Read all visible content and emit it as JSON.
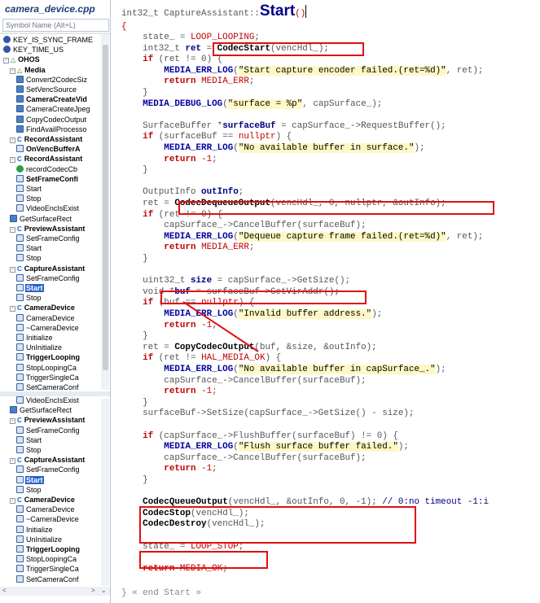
{
  "sidebar": {
    "file_title": "camera_device.cpp",
    "search_placeholder": "Symbol Name (Alt+L)",
    "items": [
      {
        "label": "KEY_IS_SYNC_FRAME",
        "icon": "key",
        "indent": 0
      },
      {
        "label": "KEY_TIME_US",
        "icon": "key",
        "indent": 0
      },
      {
        "label": "OHOS",
        "icon": "namespace",
        "indent": 0,
        "bold": true,
        "toggle": "-"
      },
      {
        "label": "Media",
        "icon": "namespace",
        "indent": 1,
        "bold": true,
        "toggle": "-"
      },
      {
        "label": "Convert2CodecSiz",
        "icon": "func",
        "indent": 2
      },
      {
        "label": "SetVencSource",
        "icon": "func",
        "indent": 2
      },
      {
        "label": "CameraCreateVid",
        "icon": "func",
        "indent": 2,
        "bold": true
      },
      {
        "label": "CameraCreateJpeg",
        "icon": "func",
        "indent": 2
      },
      {
        "label": "CopyCodecOutput",
        "icon": "func",
        "indent": 2
      },
      {
        "label": "FindAvailProcesso",
        "icon": "func",
        "indent": 2
      },
      {
        "label": "RecordAssistant",
        "icon": "class",
        "indent": 1,
        "bold": true,
        "toggle": "-"
      },
      {
        "label": "OnVencBufferA",
        "icon": "method",
        "indent": 2,
        "bold": true
      },
      {
        "label": "RecordAssistant",
        "icon": "class",
        "indent": 1,
        "bold": true,
        "toggle": "-"
      },
      {
        "label": "recordCodecCb",
        "icon": "green",
        "indent": 2
      },
      {
        "label": "SetFrameConfi",
        "icon": "method",
        "indent": 2,
        "bold": true
      },
      {
        "label": "Start",
        "icon": "method",
        "indent": 2
      },
      {
        "label": "Stop",
        "icon": "method",
        "indent": 2
      },
      {
        "label": "VideoEncIsExist",
        "icon": "method",
        "indent": 2
      },
      {
        "label": "GetSurfaceRect",
        "icon": "func",
        "indent": 1
      },
      {
        "label": "PreviewAssistant",
        "icon": "class",
        "indent": 1,
        "bold": true,
        "toggle": "-"
      },
      {
        "label": "SetFrameConfig",
        "icon": "method",
        "indent": 2
      },
      {
        "label": "Start",
        "icon": "method",
        "indent": 2
      },
      {
        "label": "Stop",
        "icon": "method",
        "indent": 2
      },
      {
        "label": "CaptureAssistant",
        "icon": "class",
        "indent": 1,
        "bold": true,
        "toggle": "-"
      },
      {
        "label": "SetFrameConfig",
        "icon": "method",
        "indent": 2
      },
      {
        "label": "Start",
        "icon": "method",
        "indent": 2,
        "bold": true,
        "selected": true
      },
      {
        "label": "Stop",
        "icon": "method",
        "indent": 2
      },
      {
        "label": "CameraDevice",
        "icon": "class",
        "indent": 1,
        "bold": true,
        "toggle": "-"
      },
      {
        "label": "CameraDevice",
        "icon": "method",
        "indent": 2
      },
      {
        "label": "~CameraDevice",
        "icon": "method",
        "indent": 2
      },
      {
        "label": "Initialize",
        "icon": "method",
        "indent": 2
      },
      {
        "label": "UnInitialize",
        "icon": "method",
        "indent": 2
      },
      {
        "label": "TriggerLooping",
        "icon": "method",
        "indent": 2,
        "bold": true
      },
      {
        "label": "StopLoopingCa",
        "icon": "method",
        "indent": 2
      },
      {
        "label": "TriggerSingleCa",
        "icon": "method",
        "indent": 2
      },
      {
        "label": "SetCameraConf",
        "icon": "method",
        "indent": 2
      }
    ],
    "items2": [
      {
        "label": "VideoEncIsExist",
        "icon": "method",
        "indent": 2
      },
      {
        "label": "GetSurfaceRect",
        "icon": "func",
        "indent": 1
      },
      {
        "label": "PreviewAssistant",
        "icon": "class",
        "indent": 1,
        "bold": true,
        "toggle": "-"
      },
      {
        "label": "SetFrameConfig",
        "icon": "method",
        "indent": 2
      },
      {
        "label": "Start",
        "icon": "method",
        "indent": 2
      },
      {
        "label": "Stop",
        "icon": "method",
        "indent": 2
      },
      {
        "label": "CaptureAssistant",
        "icon": "class",
        "indent": 1,
        "bold": true,
        "toggle": "-"
      },
      {
        "label": "SetFrameConfig",
        "icon": "method",
        "indent": 2
      },
      {
        "label": "Start",
        "icon": "method",
        "indent": 2,
        "bold": true,
        "selected": true
      },
      {
        "label": "Stop",
        "icon": "method",
        "indent": 2
      },
      {
        "label": "CameraDevice",
        "icon": "class",
        "indent": 1,
        "bold": true,
        "toggle": "-"
      },
      {
        "label": "CameraDevice",
        "icon": "method",
        "indent": 2
      },
      {
        "label": "~CameraDevice",
        "icon": "method",
        "indent": 2
      },
      {
        "label": "Initialize",
        "icon": "method",
        "indent": 2
      },
      {
        "label": "UnInitialize",
        "icon": "method",
        "indent": 2
      },
      {
        "label": "TriggerLooping",
        "icon": "method",
        "indent": 2,
        "bold": true
      },
      {
        "label": "StopLoopingCa",
        "icon": "method",
        "indent": 2
      },
      {
        "label": "TriggerSingleCa",
        "icon": "method",
        "indent": 2
      },
      {
        "label": "SetCameraConf",
        "icon": "method",
        "indent": 2
      }
    ]
  },
  "code": {
    "header_prefix": "int32_t CaptureAssistant::",
    "header_func": "Start",
    "header_suffix": "()",
    "open_brace": "{",
    "end_comment": "} « end Start »",
    "lines": [
      [
        [
          "t",
          "    state_ = "
        ],
        [
          "num",
          "LOOP_LOOPING"
        ],
        [
          "t",
          ";"
        ]
      ],
      [
        [
          "t",
          "    int32_t "
        ],
        [
          "var",
          "ret"
        ],
        [
          "t",
          " = "
        ],
        [
          "fn",
          "CodecStart"
        ],
        [
          "t",
          "(vencHdl_);"
        ]
      ],
      [
        [
          "t",
          "    "
        ],
        [
          "kw",
          "if"
        ],
        [
          "t",
          " (ret != 0) {"
        ]
      ],
      [
        [
          "t",
          "        "
        ],
        [
          "mac",
          "MEDIA_ERR_LOG"
        ],
        [
          "t",
          "("
        ],
        [
          "str",
          "\"Start capture encoder failed.(ret=%d)\""
        ],
        [
          "t",
          ", ret);"
        ]
      ],
      [
        [
          "t",
          "        "
        ],
        [
          "kw",
          "return"
        ],
        [
          "t",
          " "
        ],
        [
          "num",
          "MEDIA_ERR"
        ],
        [
          "t",
          ";"
        ]
      ],
      [
        [
          "t",
          "    }"
        ]
      ],
      [
        [
          "t",
          "    "
        ],
        [
          "mac",
          "MEDIA_DEBUG_LOG"
        ],
        [
          "t",
          "("
        ],
        [
          "str",
          "\"surface = %p\""
        ],
        [
          "t",
          ", capSurface_);"
        ]
      ],
      [
        [
          "t",
          ""
        ]
      ],
      [
        [
          "t",
          "    SurfaceBuffer *"
        ],
        [
          "var",
          "surfaceBuf"
        ],
        [
          "t",
          " = capSurface_->RequestBuffer();"
        ]
      ],
      [
        [
          "t",
          "    "
        ],
        [
          "kw",
          "if"
        ],
        [
          "t",
          " (surfaceBuf == "
        ],
        [
          "num",
          "nullptr"
        ],
        [
          "t",
          ") {"
        ]
      ],
      [
        [
          "t",
          "        "
        ],
        [
          "mac",
          "MEDIA_ERR_LOG"
        ],
        [
          "t",
          "("
        ],
        [
          "str",
          "\"No available buffer in surface.\""
        ],
        [
          "t",
          ");"
        ]
      ],
      [
        [
          "t",
          "        "
        ],
        [
          "kw",
          "return"
        ],
        [
          "t",
          " "
        ],
        [
          "num",
          "-1"
        ],
        [
          "t",
          ";"
        ]
      ],
      [
        [
          "t",
          "    }"
        ]
      ],
      [
        [
          "t",
          ""
        ]
      ],
      [
        [
          "t",
          "    OutputInfo "
        ],
        [
          "var",
          "outInfo"
        ],
        [
          "t",
          ";"
        ]
      ],
      [
        [
          "t",
          "    ret = "
        ],
        [
          "fn",
          "CodecDequeueOutput"
        ],
        [
          "t",
          "(vencHdl_, 0, nullptr, &outInfo);"
        ]
      ],
      [
        [
          "t",
          "    "
        ],
        [
          "kw",
          "if"
        ],
        [
          "t",
          " (ret != 0) {"
        ]
      ],
      [
        [
          "t",
          "        capSurface_->CancelBuffer(surfaceBuf);"
        ]
      ],
      [
        [
          "t",
          "        "
        ],
        [
          "mac",
          "MEDIA_ERR_LOG"
        ],
        [
          "t",
          "("
        ],
        [
          "str",
          "\"Dequeue capture frame failed.(ret=%d)\""
        ],
        [
          "t",
          ", ret);"
        ]
      ],
      [
        [
          "t",
          "        "
        ],
        [
          "kw",
          "return"
        ],
        [
          "t",
          " "
        ],
        [
          "num",
          "MEDIA_ERR"
        ],
        [
          "t",
          ";"
        ]
      ],
      [
        [
          "t",
          "    }"
        ]
      ],
      [
        [
          "t",
          ""
        ]
      ],
      [
        [
          "t",
          "    uint32_t "
        ],
        [
          "var",
          "size"
        ],
        [
          "t",
          " = capSurface_->GetSize();"
        ]
      ],
      [
        [
          "t",
          "    void *"
        ],
        [
          "var",
          "buf"
        ],
        [
          "t",
          " = surfaceBuf->GetVirAddr();"
        ]
      ],
      [
        [
          "t",
          "    "
        ],
        [
          "kw",
          "if"
        ],
        [
          "t",
          " (buf == "
        ],
        [
          "num",
          "nullptr"
        ],
        [
          "t",
          ") {"
        ]
      ],
      [
        [
          "t",
          "        "
        ],
        [
          "mac",
          "MEDIA_ERR_LOG"
        ],
        [
          "t",
          "("
        ],
        [
          "str",
          "\"Invalid buffer address.\""
        ],
        [
          "t",
          ");"
        ]
      ],
      [
        [
          "t",
          "        "
        ],
        [
          "kw",
          "return"
        ],
        [
          "t",
          " "
        ],
        [
          "num",
          "-1"
        ],
        [
          "t",
          ";"
        ]
      ],
      [
        [
          "t",
          "    }"
        ]
      ],
      [
        [
          "t",
          "    ret = "
        ],
        [
          "fn",
          "CopyCodecOutput"
        ],
        [
          "t",
          "(buf, &size, &outInfo);"
        ]
      ],
      [
        [
          "t",
          "    "
        ],
        [
          "kw",
          "if"
        ],
        [
          "t",
          " (ret != "
        ],
        [
          "num",
          "HAL_MEDIA_OK"
        ],
        [
          "t",
          ") {"
        ]
      ],
      [
        [
          "t",
          "        "
        ],
        [
          "mac",
          "MEDIA_ERR_LOG"
        ],
        [
          "t",
          "("
        ],
        [
          "str",
          "\"No available buffer in capSurface_.\""
        ],
        [
          "t",
          ");"
        ]
      ],
      [
        [
          "t",
          "        capSurface_->CancelBuffer(surfaceBuf);"
        ]
      ],
      [
        [
          "t",
          "        "
        ],
        [
          "kw",
          "return"
        ],
        [
          "t",
          " "
        ],
        [
          "num",
          "-1"
        ],
        [
          "t",
          ";"
        ]
      ],
      [
        [
          "t",
          "    }"
        ]
      ],
      [
        [
          "t",
          "    surfaceBuf->SetSize(capSurface_->GetSize() - size);"
        ]
      ],
      [
        [
          "t",
          ""
        ]
      ],
      [
        [
          "t",
          "    "
        ],
        [
          "kw",
          "if"
        ],
        [
          "t",
          " (capSurface_->FlushBuffer(surfaceBuf) != 0) {"
        ]
      ],
      [
        [
          "t",
          "        "
        ],
        [
          "mac",
          "MEDIA_ERR_LOG"
        ],
        [
          "t",
          "("
        ],
        [
          "str",
          "\"Flush surface buffer failed.\""
        ],
        [
          "t",
          ");"
        ]
      ],
      [
        [
          "t",
          "        capSurface_->CancelBuffer(surfaceBuf);"
        ]
      ],
      [
        [
          "t",
          "        "
        ],
        [
          "kw",
          "return"
        ],
        [
          "t",
          " "
        ],
        [
          "num",
          "-1"
        ],
        [
          "t",
          ";"
        ]
      ],
      [
        [
          "t",
          "    }"
        ]
      ],
      [
        [
          "t",
          ""
        ]
      ],
      [
        [
          "t",
          "    "
        ],
        [
          "fn",
          "CodecQueueOutput"
        ],
        [
          "t",
          "(vencHdl_, &outInfo, 0, -1); "
        ],
        [
          "cm",
          "// 0:no timeout -1:i"
        ]
      ],
      [
        [
          "t",
          "    "
        ],
        [
          "fn",
          "CodecStop"
        ],
        [
          "t",
          "(vencHdl_);"
        ]
      ],
      [
        [
          "t",
          "    "
        ],
        [
          "fn",
          "CodecDestroy"
        ],
        [
          "t",
          "(vencHdl_);"
        ]
      ],
      [
        [
          "t",
          ""
        ]
      ],
      [
        [
          "t",
          "    state_ = "
        ],
        [
          "num",
          "LOOP_STOP"
        ],
        [
          "t",
          ";"
        ]
      ],
      [
        [
          "t",
          ""
        ]
      ],
      [
        [
          "t",
          "    "
        ],
        [
          "kw",
          "return"
        ],
        [
          "t",
          " "
        ],
        [
          "num",
          "MEDIA_OK"
        ],
        [
          "t",
          ";"
        ]
      ]
    ]
  }
}
